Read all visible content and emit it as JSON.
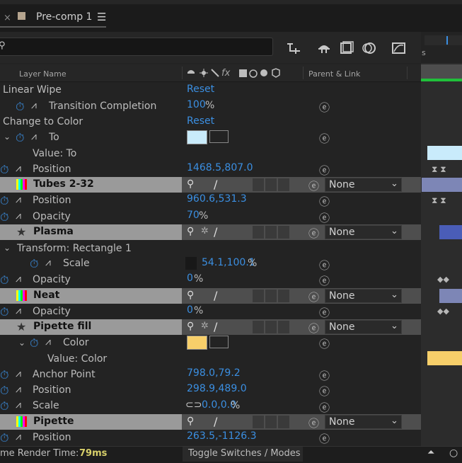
{
  "tab": {
    "close": "×",
    "title": "Pre-comp 1",
    "menu": "☰"
  },
  "header": {
    "layer_name": "Layer Name",
    "parent_link": "Parent & Link",
    "fx": "fx"
  },
  "rows": {
    "r0": {
      "name": "Linear Wipe",
      "value": "Reset"
    },
    "r1": {
      "name": "Transition Completion",
      "value": "100",
      "unit": "%"
    },
    "r2": {
      "name": "Change to Color",
      "value": "Reset"
    },
    "r3": {
      "name": "To"
    },
    "r4": {
      "name": "Value: To"
    },
    "r5": {
      "name": "Position",
      "value": "1468.5,807.0"
    },
    "r6": {
      "name": "Tubes 2-32",
      "parent": "None"
    },
    "r7": {
      "name": "Position",
      "value": "960.6,531.3"
    },
    "r8": {
      "name": "Opacity",
      "value": "70",
      "unit": "%"
    },
    "r9": {
      "name": "Plasma",
      "parent": "None"
    },
    "r10": {
      "name": "Transform: Rectangle 1"
    },
    "r11": {
      "name": "Scale",
      "value": "54.1,100.1",
      "unit": "%"
    },
    "r12": {
      "name": "Opacity",
      "value": "0",
      "unit": "%"
    },
    "r13": {
      "name": "Neat",
      "parent": "None"
    },
    "r14": {
      "name": "Opacity",
      "value": "0",
      "unit": "%"
    },
    "r15": {
      "name": "Pipette fill",
      "parent": "None"
    },
    "r16": {
      "name": "Color"
    },
    "r17": {
      "name": "Value: Color"
    },
    "r18": {
      "name": "Anchor Point",
      "value": "798.0,79.2"
    },
    "r19": {
      "name": "Position",
      "value": "298.9,489.0"
    },
    "r20": {
      "name": "Scale",
      "value": "0.0,0.0",
      "unit": "%"
    },
    "r21": {
      "name": "Pipette",
      "parent": "None"
    },
    "r22": {
      "name": "Position",
      "value": "263.5,-1126.3"
    }
  },
  "status": {
    "render_label": "me Render Time:",
    "render_value": "79ms",
    "toggle": "Toggle Switches / Modes"
  },
  "timeline": {
    "marker_label": "s"
  },
  "colors": {
    "accent_blue": "#3b8fe2",
    "swatch_to": "#c9ebfb",
    "swatch_color": "#f7cf6a",
    "green_bar": "#20c03a"
  }
}
